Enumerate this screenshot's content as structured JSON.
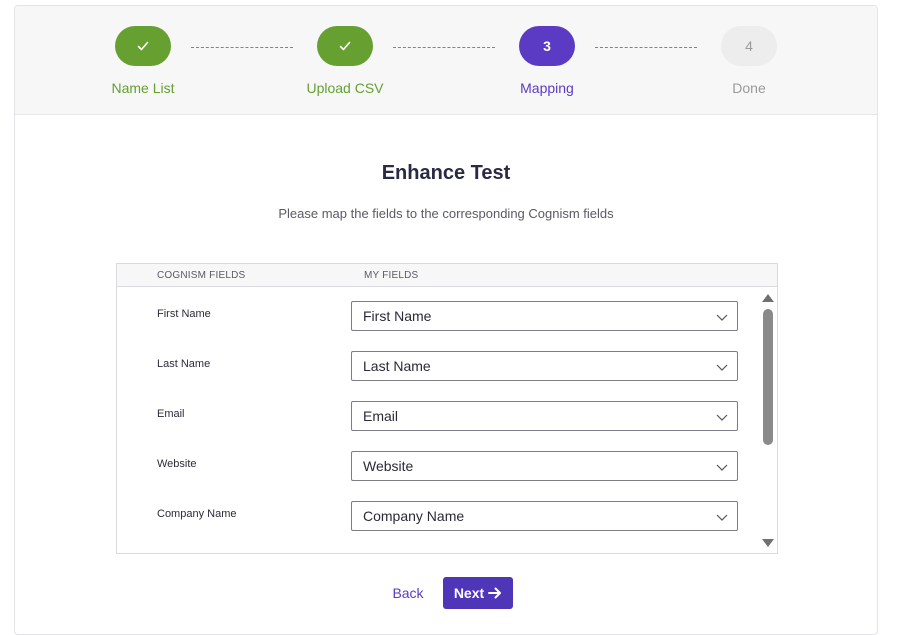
{
  "stepper": {
    "steps": [
      {
        "badge": "✓",
        "label": "Name List",
        "state": "done"
      },
      {
        "badge": "✓",
        "label": "Upload CSV",
        "state": "done"
      },
      {
        "badge": "3",
        "label": "Mapping",
        "state": "active"
      },
      {
        "badge": "4",
        "label": "Done",
        "state": "pending"
      }
    ]
  },
  "page": {
    "title": "Enhance Test",
    "subtitle": "Please map the fields to the corresponding Cognism fields"
  },
  "table": {
    "headers": {
      "cognism": "COGNISM FIELDS",
      "mine": "MY FIELDS"
    },
    "rows": [
      {
        "field": "First Name",
        "value": "First Name"
      },
      {
        "field": "Last Name",
        "value": "Last Name"
      },
      {
        "field": "Email",
        "value": "Email"
      },
      {
        "field": "Website",
        "value": "Website"
      },
      {
        "field": "Company Name",
        "value": "Company Name"
      }
    ]
  },
  "actions": {
    "back": "Back",
    "next": "Next"
  },
  "icons": {
    "select": "chevron-down-icon",
    "next": "arrow-right-icon",
    "done_step": "check-icon"
  },
  "colors": {
    "done": "#65a030",
    "active": "#5b3bc4",
    "pending": "#9a9a9a",
    "primary_button": "#4f35b8"
  }
}
